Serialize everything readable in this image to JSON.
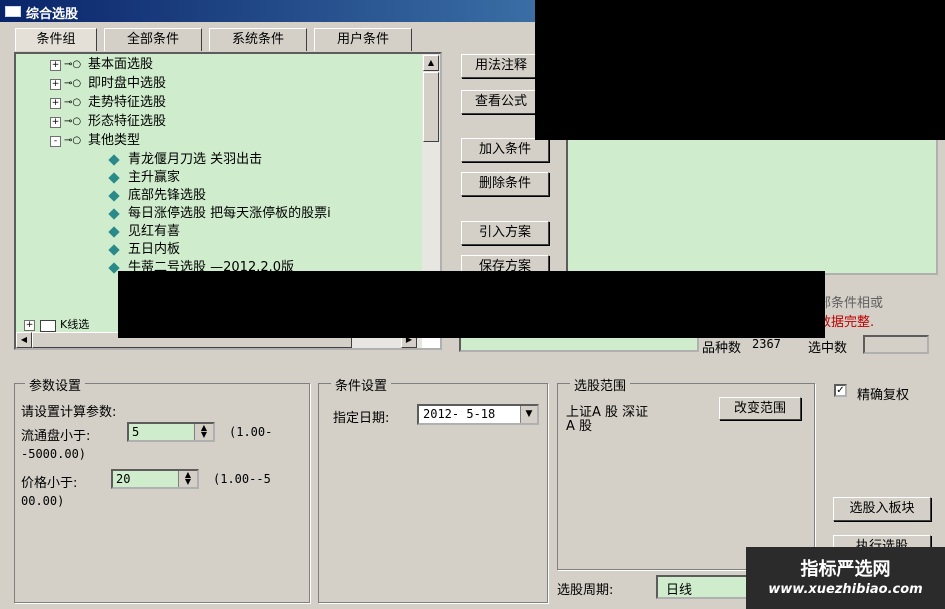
{
  "window": {
    "title": "综合选股"
  },
  "tabs": [
    "条件组",
    "全部条件",
    "系统条件",
    "用户条件"
  ],
  "tree": {
    "groups": [
      {
        "label": "基本面选股",
        "expander": "+"
      },
      {
        "label": "即时盘中选股",
        "expander": "+"
      },
      {
        "label": "走势特征选股",
        "expander": "+"
      },
      {
        "label": "形态特征选股",
        "expander": "+"
      },
      {
        "label": "其他类型",
        "expander": "-"
      }
    ],
    "leaves": [
      "青龙偃月刀选 关羽出击",
      "主升赢家",
      "底部先锋选股",
      "每日涨停选股 把每天涨停板的股票i",
      "见红有喜",
      "五日内板",
      "牛蒂二号选股 —2012.2.0版"
    ],
    "partial_group": "K线选"
  },
  "side_buttons": [
    "用法注释",
    "查看公式",
    "加入条件",
    "删除条件",
    "引入方案",
    "保存方案"
  ],
  "right_pane": {
    "hint_line1": "部条件相或",
    "hint_line2": "数据完整.",
    "count_label": "品种数",
    "count_value": "2367",
    "selected_label": "选中数",
    "selected_value": ""
  },
  "params": {
    "group_title": "参数设置",
    "prompt": "请设置计算参数:",
    "float_label": "流通盘小于:",
    "float_value": "5",
    "float_range_1": "(1.00-",
    "float_range_2": "-5000.00)",
    "price_label": "价格小于:",
    "price_value": "20",
    "price_range_1": "(1.00--5",
    "price_range_2": "00.00)"
  },
  "cond": {
    "group_title": "条件设置",
    "date_label": "指定日期:",
    "date_value": "2012- 5-18"
  },
  "scope": {
    "group_title": "选股范围",
    "text_line1": "上证A 股  深证",
    "text_line2": "A 股",
    "change_button": "改变范围",
    "period_label": "选股周期:",
    "period_value": "日线"
  },
  "right_controls": {
    "exact_checkbox_label": "精确复权",
    "exact_checked": true,
    "to_block_button": "选股入板块",
    "execute_button": "执行选股"
  },
  "watermark": {
    "line1": "指标严选网",
    "line2": "www.xuezhibiao.com"
  }
}
